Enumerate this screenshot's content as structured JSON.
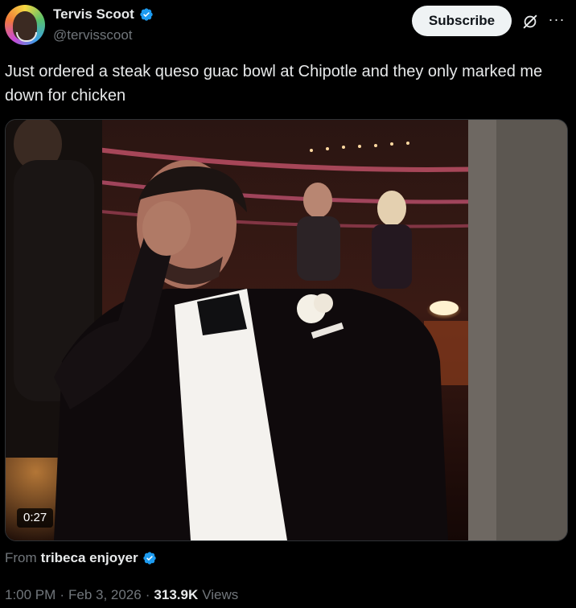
{
  "author": {
    "display_name": "Tervis Scoot",
    "handle": "@tervisscoot",
    "verified_icon": "verified-badge-icon",
    "avatar_icon": "avatar"
  },
  "actions": {
    "subscribe_label": "Subscribe",
    "grok_icon": "grok-icon",
    "more_icon": "more-icon"
  },
  "tweet": {
    "text": "Just ordered a steak queso guac bowl at Chipotle and they only marked me down for chicken"
  },
  "media": {
    "duration": "0:27"
  },
  "attribution": {
    "from_label": "From",
    "source_name": "tribeca enjoyer"
  },
  "meta": {
    "time": "1:00 PM",
    "sep1": "·",
    "date": "Feb 3, 2026",
    "sep2": "·",
    "views_count": "313.9K",
    "views_label": "Views"
  },
  "colors": {
    "background": "#000000",
    "text": "#e7e9ea",
    "secondary_text": "#71767b",
    "verified": "#1d9bf0",
    "button_bg": "#eff3f4"
  }
}
